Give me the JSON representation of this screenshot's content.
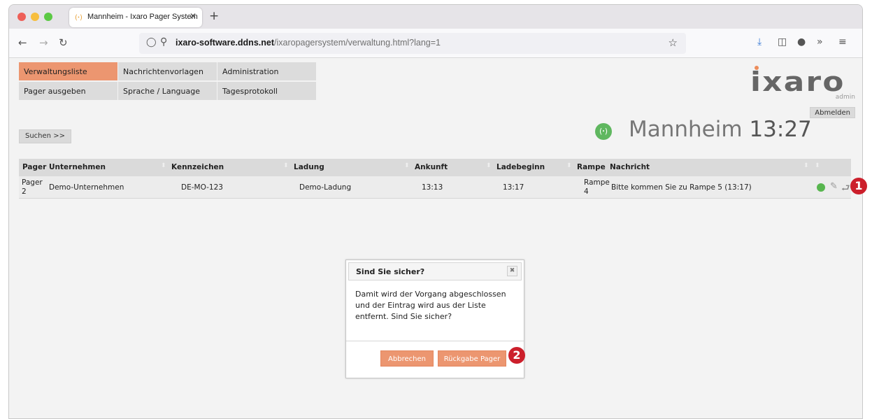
{
  "browser": {
    "tab_title": "Mannheim - Ixaro Pager System",
    "tab_icon": "(ꞏ)",
    "new_tab": "+",
    "url_host": "ixaro-software.ddns.net",
    "url_path": "/ixaropagersystem/verwaltung.html?lang=1"
  },
  "menu": {
    "items": [
      {
        "label": "Verwaltungsliste"
      },
      {
        "label": "Nachrichtenvorlagen"
      },
      {
        "label": "Administration"
      },
      {
        "label": "Pager ausgeben"
      },
      {
        "label": "Sprache / Language"
      },
      {
        "label": "Tagesprotokoll"
      }
    ],
    "active_index": 0
  },
  "header": {
    "logo": "ixaro",
    "user": "admin",
    "logout_label": "Abmelden",
    "location": "Mannheim",
    "time": "13:27",
    "signal_icon": "(ꞏ)"
  },
  "search_label": "Suchen >>",
  "table": {
    "columns": [
      "Pager",
      "Unternehmen",
      "Kennzeichen",
      "Ladung",
      "Ankunft",
      "Ladebeginn",
      "Rampe",
      "Nachricht"
    ],
    "rows": [
      {
        "pager_line1": "Pager",
        "pager_line2": "2",
        "unternehmen": "Demo-Unternehmen",
        "kennzeichen": "DE-MO-123",
        "ladung": "Demo-Ladung",
        "ankunft": "13:13",
        "ladebeginn": "13:17",
        "rampe_line1": "Rampe",
        "rampe_line2": "4",
        "nachricht": "Bitte kommen Sie zu Rampe 5 (13:17)",
        "status_color": "#58b64f"
      }
    ]
  },
  "dialog": {
    "title": "Sind Sie sicher?",
    "close_glyph": "✖",
    "body": "Damit wird der Vorgang abgeschlossen und der Eintrag wird aus der Liste entfernt. Sind Sie sicher?",
    "cancel_label": "Abbrechen",
    "confirm_label": "Rückgabe Pager"
  },
  "callouts": {
    "one": "1",
    "two": "2"
  },
  "colors": {
    "accent": "#ec9670",
    "callout": "#cc1f2b",
    "status_ok": "#58b64f"
  }
}
